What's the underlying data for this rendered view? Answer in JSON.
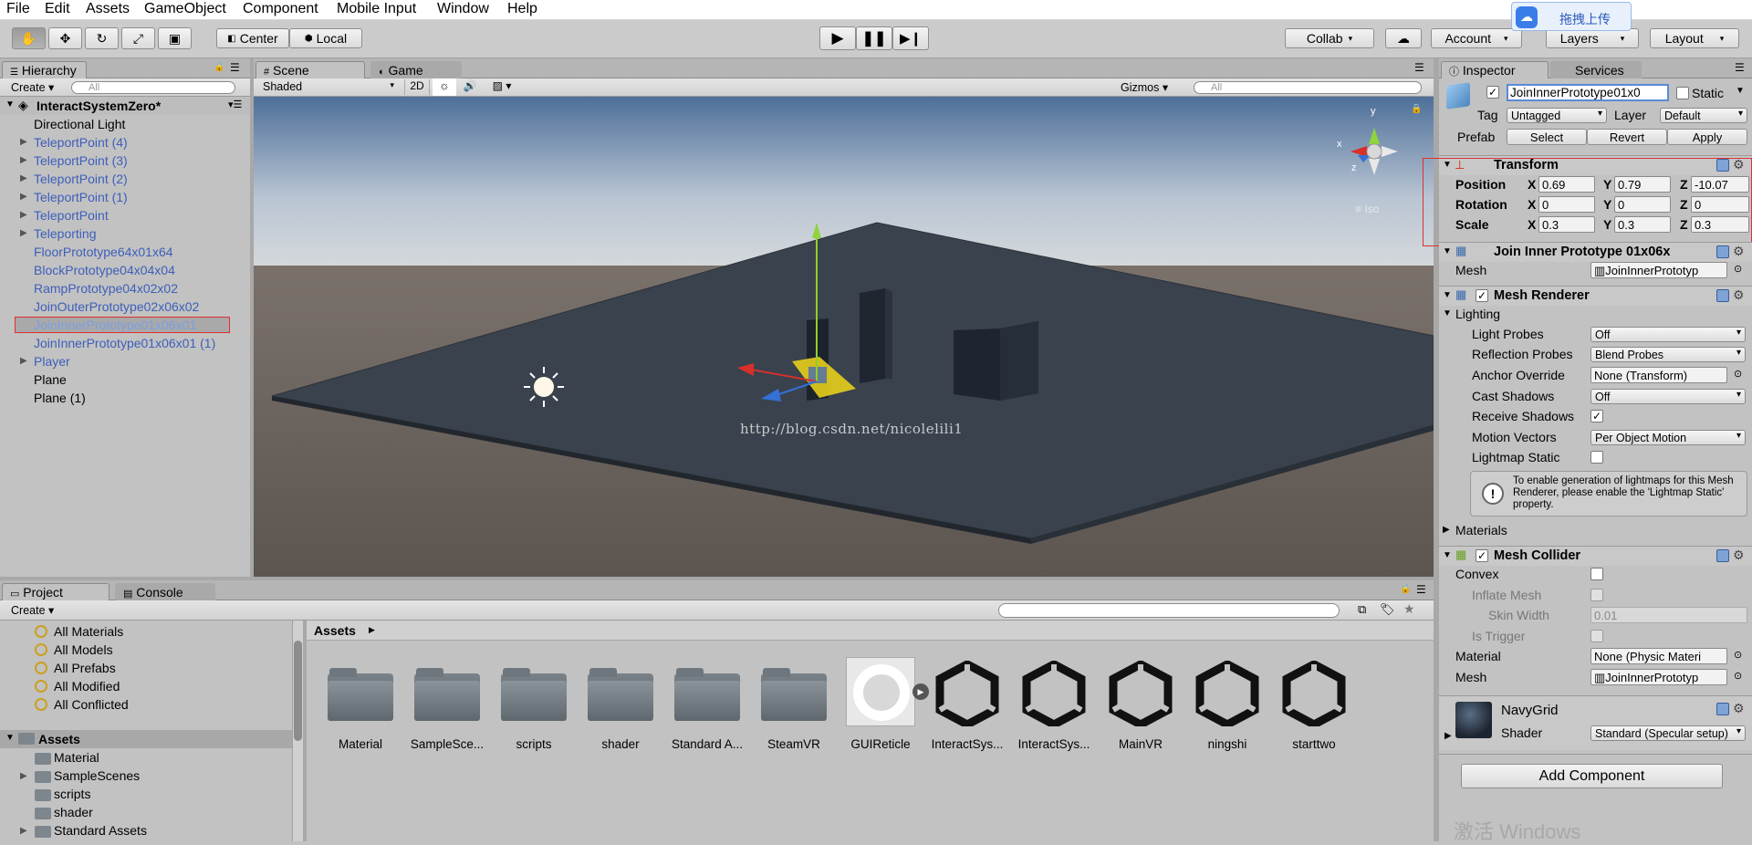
{
  "menu": [
    "File",
    "Edit",
    "Assets",
    "GameObject",
    "Component",
    "Mobile Input",
    "Window",
    "Help"
  ],
  "upload_badge": "拖拽上传",
  "toolbar": {
    "center_label": "Center",
    "local_label": "Local",
    "collab_label": "Collab",
    "account_label": "Account",
    "layers_label": "Layers",
    "layout_label": "Layout"
  },
  "hierarchy": {
    "tab": "Hierarchy",
    "create": "Create",
    "search_placeholder": "All",
    "scene_name": "InteractSystemZero*",
    "items": [
      {
        "label": "Directional Light",
        "color": "black",
        "arrow": false
      },
      {
        "label": "TeleportPoint (4)",
        "color": "blue",
        "arrow": true
      },
      {
        "label": "TeleportPoint (3)",
        "color": "blue",
        "arrow": true
      },
      {
        "label": "TeleportPoint (2)",
        "color": "blue",
        "arrow": true
      },
      {
        "label": "TeleportPoint (1)",
        "color": "blue",
        "arrow": true
      },
      {
        "label": "TeleportPoint",
        "color": "blue",
        "arrow": true
      },
      {
        "label": "Teleporting",
        "color": "blue",
        "arrow": true
      },
      {
        "label": "FloorPrototype64x01x64",
        "color": "blue",
        "arrow": false
      },
      {
        "label": "BlockPrototype04x04x04",
        "color": "blue",
        "arrow": false
      },
      {
        "label": "RampPrototype04x02x02",
        "color": "blue",
        "arrow": false
      },
      {
        "label": "JoinOuterPrototype02x06x02",
        "color": "blue",
        "arrow": false
      },
      {
        "label": "JoinInnerPrototype01x06x01",
        "color": "selected",
        "arrow": false
      },
      {
        "label": "JoinInnerPrototype01x06x01 (1)",
        "color": "blue",
        "arrow": false
      },
      {
        "label": "Player",
        "color": "blue",
        "arrow": true
      },
      {
        "label": "Plane",
        "color": "black",
        "arrow": false
      },
      {
        "label": "Plane (1)",
        "color": "black",
        "arrow": false
      }
    ]
  },
  "scene": {
    "tab_scene": "Scene",
    "tab_game": "Game",
    "shading": "Shaded",
    "mode_2d": "2D",
    "gizmos": "Gizmos",
    "search_placeholder": "All",
    "persp_label": "Iso",
    "watermark": "http://blog.csdn.net/nicolelili1",
    "gizmo_axes": [
      "y",
      "x",
      "z"
    ]
  },
  "inspector": {
    "tab": "Inspector",
    "tab_services": "Services",
    "object_name": "JoinInnerPrototype01x0",
    "static_label": "Static",
    "tag_label": "Tag",
    "tag_value": "Untagged",
    "layer_label": "Layer",
    "layer_value": "Default",
    "prefab_label": "Prefab",
    "prefab_select": "Select",
    "prefab_revert": "Revert",
    "prefab_apply": "Apply",
    "transform": {
      "title": "Transform",
      "position_label": "Position",
      "rotation_label": "Rotation",
      "scale_label": "Scale",
      "position": [
        "0.69",
        "0.79",
        "-10.07"
      ],
      "rotation": [
        "0",
        "0",
        "0"
      ],
      "scale": [
        "0.3",
        "0.3",
        "0.3"
      ],
      "axes": [
        "X",
        "Y",
        "Z"
      ]
    },
    "mesh_filter": {
      "title": "Join Inner Prototype 01x06x",
      "mesh_label": "Mesh",
      "mesh_value": "JoinInnerPrototyp"
    },
    "mesh_renderer": {
      "title": "Mesh Renderer",
      "lighting": "Lighting",
      "light_probes_label": "Light Probes",
      "light_probes_value": "Off",
      "reflection_probes_label": "Reflection Probes",
      "reflection_probes_value": "Blend Probes",
      "anchor_override_label": "Anchor Override",
      "anchor_override_value": "None (Transform)",
      "cast_shadows_label": "Cast Shadows",
      "cast_shadows_value": "Off",
      "receive_shadows_label": "Receive Shadows",
      "motion_vectors_label": "Motion Vectors",
      "motion_vectors_value": "Per Object Motion",
      "lightmap_static_label": "Lightmap Static",
      "info": "To enable generation of lightmaps for this Mesh Renderer, please enable the 'Lightmap Static' property.",
      "materials": "Materials"
    },
    "mesh_collider": {
      "title": "Mesh Collider",
      "convex_label": "Convex",
      "inflate_label": "Inflate Mesh",
      "skin_width_label": "Skin Width",
      "skin_width_value": "0.01",
      "trigger_label": "Is Trigger",
      "material_label": "Material",
      "material_value": "None (Physic Materi",
      "mesh_label": "Mesh",
      "mesh_value": "JoinInnerPrototyp"
    },
    "material": {
      "name": "NavyGrid",
      "shader_label": "Shader",
      "shader_value": "Standard (Specular setup)"
    },
    "add_component": "Add Component",
    "windows_watermark": "激活 Windows"
  },
  "project": {
    "tab_project": "Project",
    "tab_console": "Console",
    "create": "Create",
    "favorites": [
      "All Materials",
      "All Models",
      "All Prefabs",
      "All Modified",
      "All Conflicted"
    ],
    "assets_root": "Assets",
    "folders": [
      {
        "label": "Material",
        "arrow": false
      },
      {
        "label": "SampleScenes",
        "arrow": true
      },
      {
        "label": "scripts",
        "arrow": false
      },
      {
        "label": "shader",
        "arrow": false
      },
      {
        "label": "Standard Assets",
        "arrow": true
      }
    ],
    "breadcrumb": "Assets",
    "grid": [
      {
        "label": "Material",
        "kind": "folder"
      },
      {
        "label": "SampleSce...",
        "kind": "folder"
      },
      {
        "label": "scripts",
        "kind": "folder"
      },
      {
        "label": "shader",
        "kind": "folder"
      },
      {
        "label": "Standard A...",
        "kind": "folder"
      },
      {
        "label": "SteamVR",
        "kind": "folder"
      },
      {
        "label": "GUIReticle",
        "kind": "ring"
      },
      {
        "label": "InteractSys...",
        "kind": "unity"
      },
      {
        "label": "InteractSys...",
        "kind": "unity"
      },
      {
        "label": "MainVR",
        "kind": "unity"
      },
      {
        "label": "ningshi",
        "kind": "unity"
      },
      {
        "label": "starttwo",
        "kind": "unity"
      }
    ]
  }
}
